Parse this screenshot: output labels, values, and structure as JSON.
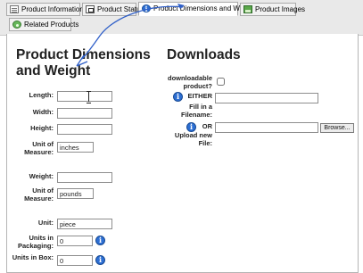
{
  "tabs": [
    {
      "label": "Product Information",
      "icon": "document-icon"
    },
    {
      "label": "Product Status",
      "icon": "status-icon"
    },
    {
      "label": "Product Dimensions and Weight",
      "icon": "info-icon",
      "active": true
    },
    {
      "label": "Product Images",
      "icon": "image-icon"
    },
    {
      "label": "Related Products",
      "icon": "related-icon"
    }
  ],
  "dimensions": {
    "title": "Product Dimensions and Weight",
    "length_label": "Length:",
    "length_value": "",
    "width_label": "Width:",
    "width_value": "",
    "height_label": "Height:",
    "height_value": "",
    "dim_unit_label": "Unit of Measure:",
    "dim_unit_value": "inches",
    "weight_label": "Weight:",
    "weight_value": "",
    "weight_unit_label": "Unit of Measure:",
    "weight_unit_value": "pounds",
    "unit_label": "Unit:",
    "unit_value": "piece",
    "units_packaging_label": "Units in Packaging:",
    "units_packaging_value": "0",
    "units_box_label": "Units in Box:",
    "units_box_value": "0"
  },
  "downloads": {
    "title": "Downloads",
    "downloadable_label": "downloadable product?",
    "downloadable_checked": false,
    "either_label": "EITHER",
    "filename_label": "Fill in a Filename:",
    "filename_value": "",
    "or_label": "OR",
    "upload_label": "Upload new File:",
    "browse_label": "Browse..."
  },
  "colors": {
    "info_icon": "#2d6fd3",
    "annotation_arrow": "#2f5fc8"
  }
}
